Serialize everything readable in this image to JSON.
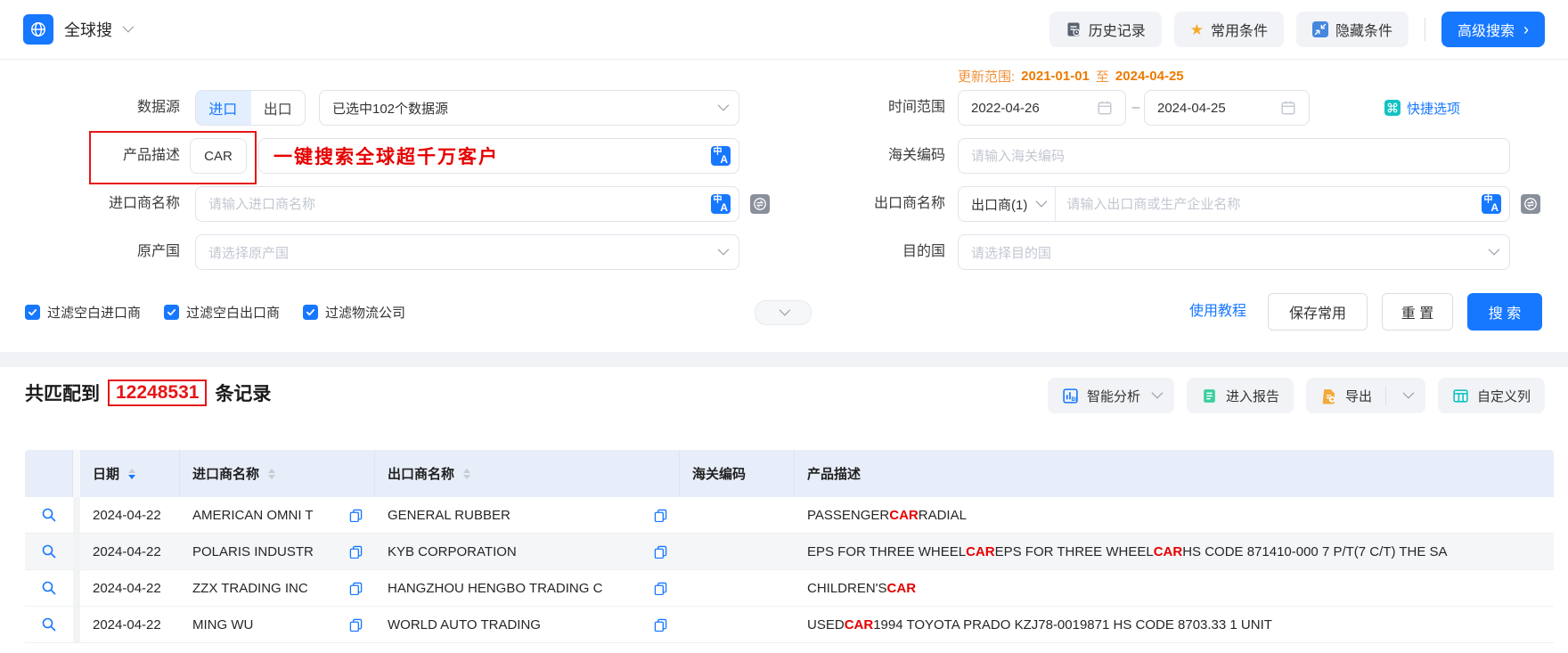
{
  "topbar": {
    "app": "全球搜",
    "history": "历史记录",
    "favorites": "常用条件",
    "hide": "隐藏条件",
    "advanced": "高级搜索",
    "advanced_arrow": "›"
  },
  "icons": {
    "star": "★",
    "translate_zh": "中",
    "translate_en": "A"
  },
  "form": {
    "update": {
      "label": "更新范围:",
      "start": "2021-01-01",
      "mid": "至",
      "end": "2024-04-25"
    },
    "source": {
      "label": "数据源",
      "import": "进口",
      "export": "出口",
      "selected": "已选中102个数据源"
    },
    "time": {
      "label": "时间范围",
      "start": "2022-04-26",
      "dash": "–",
      "end": "2024-04-25",
      "quick": "快捷选项"
    },
    "product": {
      "label": "产品描述",
      "value": "CAR",
      "annotation": "一键搜索全球超千万客户"
    },
    "hs": {
      "label": "海关编码",
      "placeholder": "请输入海关编码"
    },
    "importer": {
      "label": "进口商名称",
      "placeholder": "请输入进口商名称"
    },
    "exporter": {
      "label": "出口商名称",
      "type": "出口商(1)",
      "placeholder": "请输入出口商或生产企业名称"
    },
    "origin": {
      "label": "原产国",
      "placeholder": "请选择原产国"
    },
    "dest": {
      "label": "目的国",
      "placeholder": "请选择目的国"
    },
    "filters": [
      "过滤空白进口商",
      "过滤空白出口商",
      "过滤物流公司"
    ],
    "tutorial": "使用教程",
    "save": "保存常用",
    "reset": "重 置",
    "search": "搜 索"
  },
  "results": {
    "prefix": "共匹配到",
    "count": "12248531",
    "suffix": "条记录",
    "toolbar": {
      "analysis": "智能分析",
      "report": "进入报告",
      "export": "导出",
      "columns": "自定义列"
    }
  },
  "table": {
    "highlight": "CAR",
    "headers": [
      {
        "label": "日期",
        "sort": "desc"
      },
      {
        "label": "进口商名称",
        "sort": "none"
      },
      {
        "label": "出口商名称",
        "sort": "none"
      },
      {
        "label": "海关编码"
      },
      {
        "label": "产品描述"
      }
    ],
    "rows": [
      {
        "date": "2024-04-22",
        "importer": "AMERICAN OMNI T",
        "exporter": "GENERAL RUBBER",
        "hs": "",
        "desc": "PASSENGER CAR RADIAL"
      },
      {
        "date": "2024-04-22",
        "importer": "POLARIS INDUSTR",
        "exporter": "KYB CORPORATION",
        "hs": "",
        "desc": "EPS FOR THREE WHEEL CAR EPS FOR THREE WHEEL CAR HS CODE 871410-000 7 P/T(7 C/T) THE SA"
      },
      {
        "date": "2024-04-22",
        "importer": "ZZX TRADING INC",
        "exporter": "HANGZHOU HENGBO TRADING C",
        "hs": "",
        "desc": "CHILDREN'S CAR"
      },
      {
        "date": "2024-04-22",
        "importer": "MING WU",
        "exporter": "WORLD AUTO TRADING",
        "hs": "",
        "desc": "USED CAR 1994 TOYOTA PRADO KZJ78-0019871 HS CODE 8703.33 1 UNIT"
      }
    ]
  },
  "colors": {
    "primary": "#1677ff",
    "orange": "#ed7b01",
    "red": "#e61616",
    "teal": "#13c2c2"
  }
}
